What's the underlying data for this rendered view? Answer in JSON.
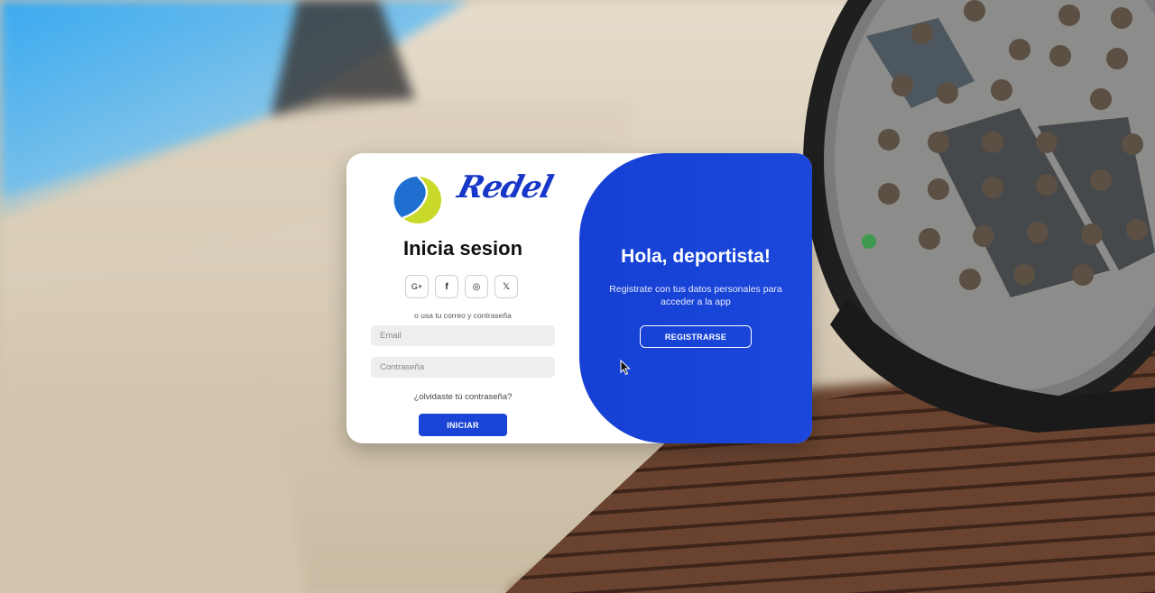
{
  "brand": {
    "logo_text": "Redel",
    "logo_icon": "tennis-ball-icon",
    "accent": "#1a44d6"
  },
  "login": {
    "title": "Inicia sesion",
    "socials": [
      {
        "icon": "google-plus-icon",
        "label": "G+"
      },
      {
        "icon": "facebook-icon",
        "label": "f"
      },
      {
        "icon": "instagram-icon",
        "label": "◎"
      },
      {
        "icon": "x-twitter-icon",
        "label": "𝕏"
      }
    ],
    "hint": "o usa tu correo y contraseña",
    "email_placeholder": "Email",
    "password_placeholder": "Contraseña",
    "forgot": "¿olvidaste tú contraseña?",
    "submit": "INICIAR"
  },
  "panel": {
    "title": "Hola, deportista!",
    "text": "Registrate con tus datos personales para acceder a la app",
    "button": "REGISTRARSE",
    "color": "#1640d4"
  }
}
